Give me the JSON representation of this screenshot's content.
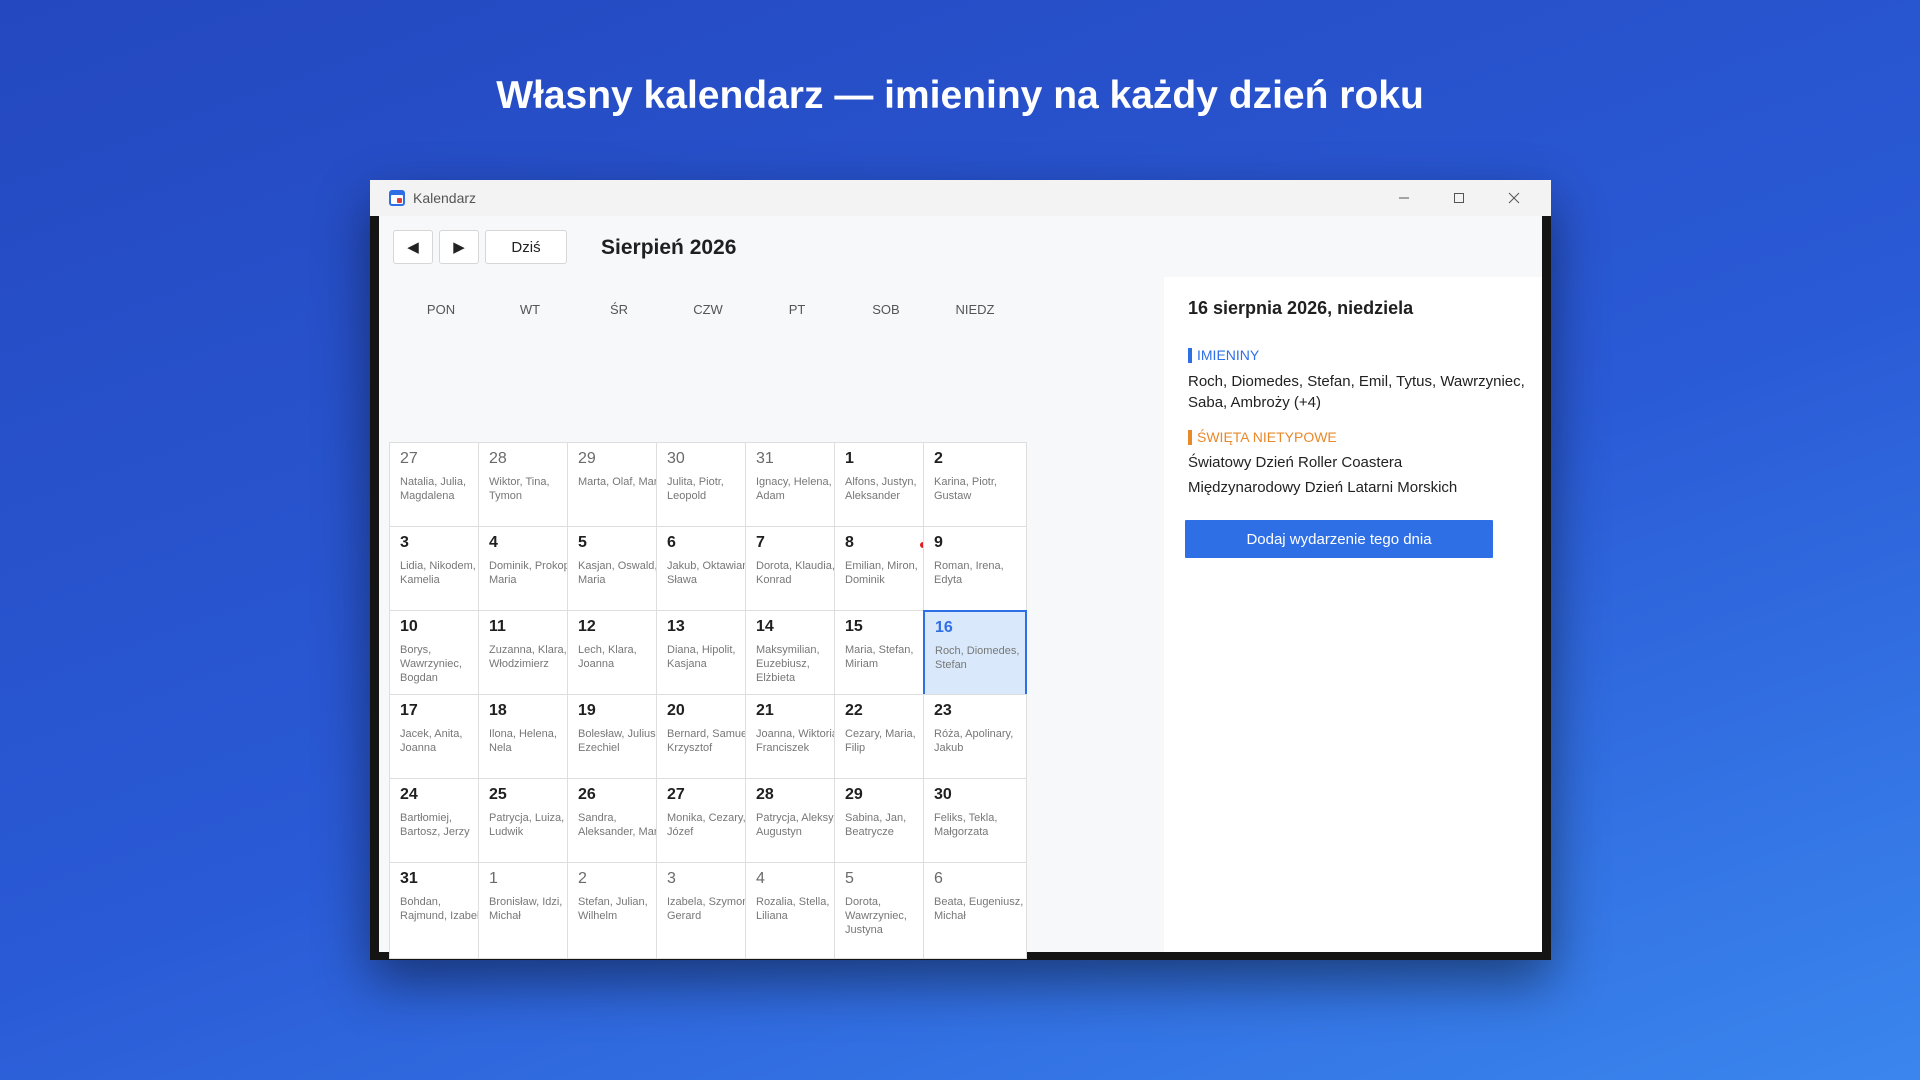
{
  "headline": "Własny kalendarz — imieniny na każdy dzień roku",
  "window": {
    "title": "Kalendarz",
    "minimize_icon": "minimize-icon",
    "maximize_icon": "maximize-icon",
    "close_icon": "close-icon"
  },
  "toolbar": {
    "prev_label": "◀",
    "next_label": "▶",
    "today_label": "Dziś",
    "month_title": "Sierpień 2026"
  },
  "weekdays": [
    "PON",
    "WT",
    "ŚR",
    "CZW",
    "PT",
    "SOB",
    "NIEDZ"
  ],
  "weeks": [
    [
      {
        "day": "27",
        "names": "Natalia, Julia, Magdalena",
        "other_month": true
      },
      {
        "day": "28",
        "names": "Wiktor, Tina, Tymon",
        "other_month": true
      },
      {
        "day": "29",
        "names": "Marta, Olaf, Maria",
        "other_month": true
      },
      {
        "day": "30",
        "names": "Julita, Piotr, Leopold",
        "other_month": true
      },
      {
        "day": "31",
        "names": "Ignacy, Helena, Adam",
        "other_month": true
      },
      {
        "day": "1",
        "names": "Alfons, Justyn, Aleksander"
      },
      {
        "day": "2",
        "names": "Karina, Piotr, Gustaw"
      }
    ],
    [
      {
        "day": "3",
        "names": "Lidia, Nikodem, Kamelia"
      },
      {
        "day": "4",
        "names": "Dominik, Prokop, Maria"
      },
      {
        "day": "5",
        "names": "Kasjan, Oswald, Maria"
      },
      {
        "day": "6",
        "names": "Jakub, Oktawian, Sława"
      },
      {
        "day": "7",
        "names": "Dorota, Klaudia, Konrad"
      },
      {
        "day": "8",
        "names": "Emilian, Miron, Dominik",
        "has_event": true
      },
      {
        "day": "9",
        "names": "Roman, Irena, Edyta"
      }
    ],
    [
      {
        "day": "10",
        "names": "Borys, Wawrzyniec, Bogdan"
      },
      {
        "day": "11",
        "names": "Zuzanna, Klara, Włodzimierz"
      },
      {
        "day": "12",
        "names": "Lech, Klara, Joanna"
      },
      {
        "day": "13",
        "names": "Diana, Hipolit, Kasjana"
      },
      {
        "day": "14",
        "names": "Maksymilian, Euzebiusz, Elżbieta"
      },
      {
        "day": "15",
        "names": "Maria, Stefan, Miriam"
      },
      {
        "day": "16",
        "names": "Roch, Diomedes, Stefan",
        "selected": true
      }
    ],
    [
      {
        "day": "17",
        "names": "Jacek, Anita, Joanna"
      },
      {
        "day": "18",
        "names": "Ilona, Helena, Nela"
      },
      {
        "day": "19",
        "names": "Bolesław, Juliusz, Ezechiel"
      },
      {
        "day": "20",
        "names": "Bernard, Samuel, Krzysztof"
      },
      {
        "day": "21",
        "names": "Joanna, Wiktoria, Franciszek"
      },
      {
        "day": "22",
        "names": "Cezary, Maria, Filip"
      },
      {
        "day": "23",
        "names": "Róża, Apolinary, Jakub"
      }
    ],
    [
      {
        "day": "24",
        "names": "Bartłomiej, Bartosz, Jerzy"
      },
      {
        "day": "25",
        "names": "Patrycja, Luiza, Ludwik"
      },
      {
        "day": "26",
        "names": "Sandra, Aleksander, Maria"
      },
      {
        "day": "27",
        "names": "Monika, Cezary, Józef"
      },
      {
        "day": "28",
        "names": "Patrycja, Aleksy, Augustyn"
      },
      {
        "day": "29",
        "names": "Sabina, Jan, Beatrycze"
      },
      {
        "day": "30",
        "names": "Feliks, Tekla, Małgorzata"
      }
    ],
    [
      {
        "day": "31",
        "names": "Bohdan, Rajmund, Izabela"
      },
      {
        "day": "1",
        "names": "Bronisław, Idzi, Michał",
        "other_month": true
      },
      {
        "day": "2",
        "names": "Stefan, Julian, Wilhelm",
        "other_month": true
      },
      {
        "day": "3",
        "names": "Izabela, Szymon, Gerard",
        "other_month": true
      },
      {
        "day": "4",
        "names": "Rozalia, Stella, Liliana",
        "other_month": true
      },
      {
        "day": "5",
        "names": "Dorota, Wawrzyniec, Justyna",
        "other_month": true
      },
      {
        "day": "6",
        "names": "Beata, Eugeniusz, Michał",
        "other_month": true
      }
    ]
  ],
  "side_panel": {
    "selected_date": "16 sierpnia 2026, niedziela",
    "names_heading": "IMIENINY",
    "names_text": "Roch, Diomedes, Stefan, Emil, Tytus, Wawrzyniec, Saba, Ambroży (+4)",
    "holidays_heading": "ŚWIĘTA NIETYPOWE",
    "holidays": [
      "Światowy Dzień Roller Coastera",
      "Międzynarodowy Dzień Latarni Morskich"
    ],
    "add_button_label": "Dodaj wydarzenie tego dnia"
  },
  "colors": {
    "accent": "#2f6fe6",
    "holiday_accent": "#e8892a",
    "event_dot": "#e02020",
    "selected_bg": "#d9e9fb"
  }
}
